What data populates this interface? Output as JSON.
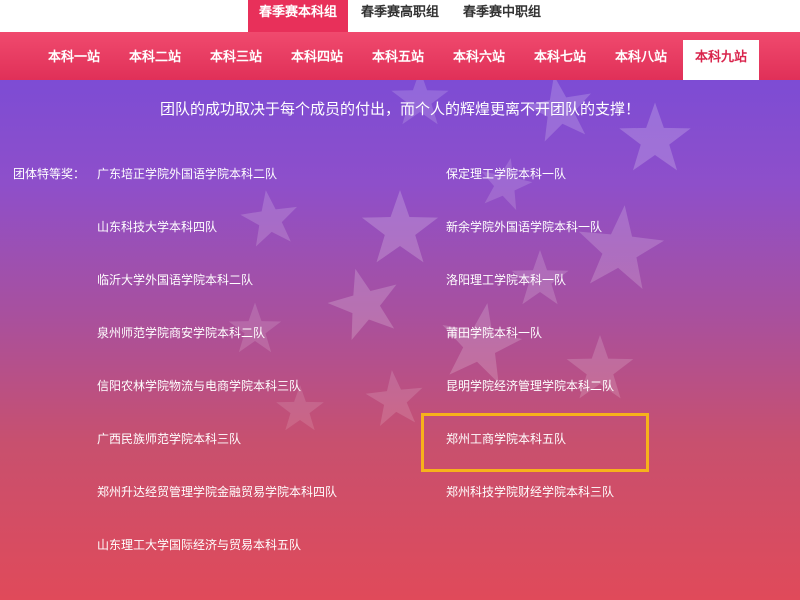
{
  "group_tabs": [
    "春季赛本科组",
    "春季赛高职组",
    "春季赛中职组"
  ],
  "group_tabs_active_index": 0,
  "station_tabs": [
    "本科一站",
    "本科二站",
    "本科三站",
    "本科四站",
    "本科五站",
    "本科六站",
    "本科七站",
    "本科八站",
    "本科九站"
  ],
  "station_tabs_active_index": 8,
  "slogan": "团队的成功取决于每个成员的付出，而个人的辉煌更离不开团队的支撑！",
  "award_label": "团体特等奖：",
  "teams_left": [
    "广东培正学院外国语学院本科二队",
    "山东科技大学本科四队",
    "临沂大学外国语学院本科二队",
    "泉州师范学院商安学院本科二队",
    "信阳农林学院物流与电商学院本科三队",
    "广西民族师范学院本科三队",
    "郑州升达经贸管理学院金融贸易学院本科四队",
    "山东理工大学国际经济与贸易本科五队"
  ],
  "teams_right": [
    "保定理工学院本科一队",
    "新余学院外国语学院本科一队",
    "洛阳理工学院本科一队",
    "莆田学院本科一队",
    "昆明学院经济管理学院本科二队",
    "郑州工商学院本科五队",
    "郑州科技学院财经学院本科三队"
  ],
  "highlighted_team": "郑州工商学院本科五队",
  "colors": {
    "accent": "#e8305a",
    "highlight_border": "#f7b21b"
  }
}
